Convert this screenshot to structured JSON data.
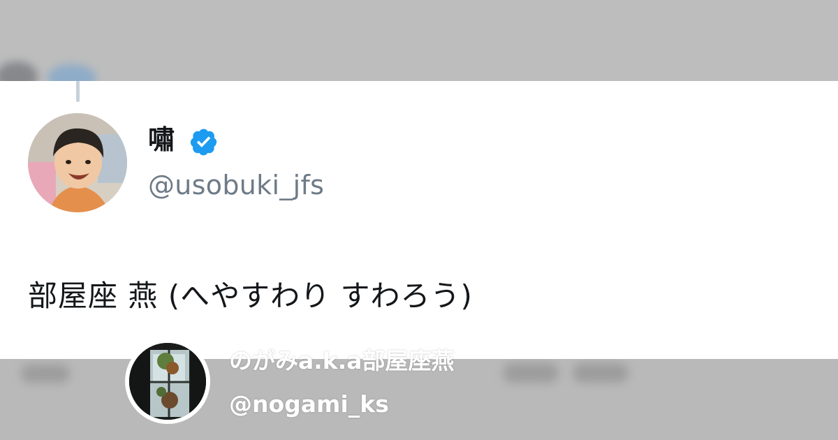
{
  "tweet": {
    "display_name": "嘯",
    "handle": "@usobuki_jfs",
    "verified": true,
    "text": "部屋座 燕 (へやすわり すわろう)",
    "colors": {
      "verified_badge": "#1d9bf0",
      "handle": "#6e7b87",
      "text": "#14171a",
      "thread_line": "#c7d1d9"
    }
  },
  "author": {
    "name": "のがみa.k.a部屋座燕",
    "handle": "@nogami_ks"
  },
  "icons": [
    "verified-badge-icon",
    "avatar-photo",
    "author-avatar-photo"
  ]
}
